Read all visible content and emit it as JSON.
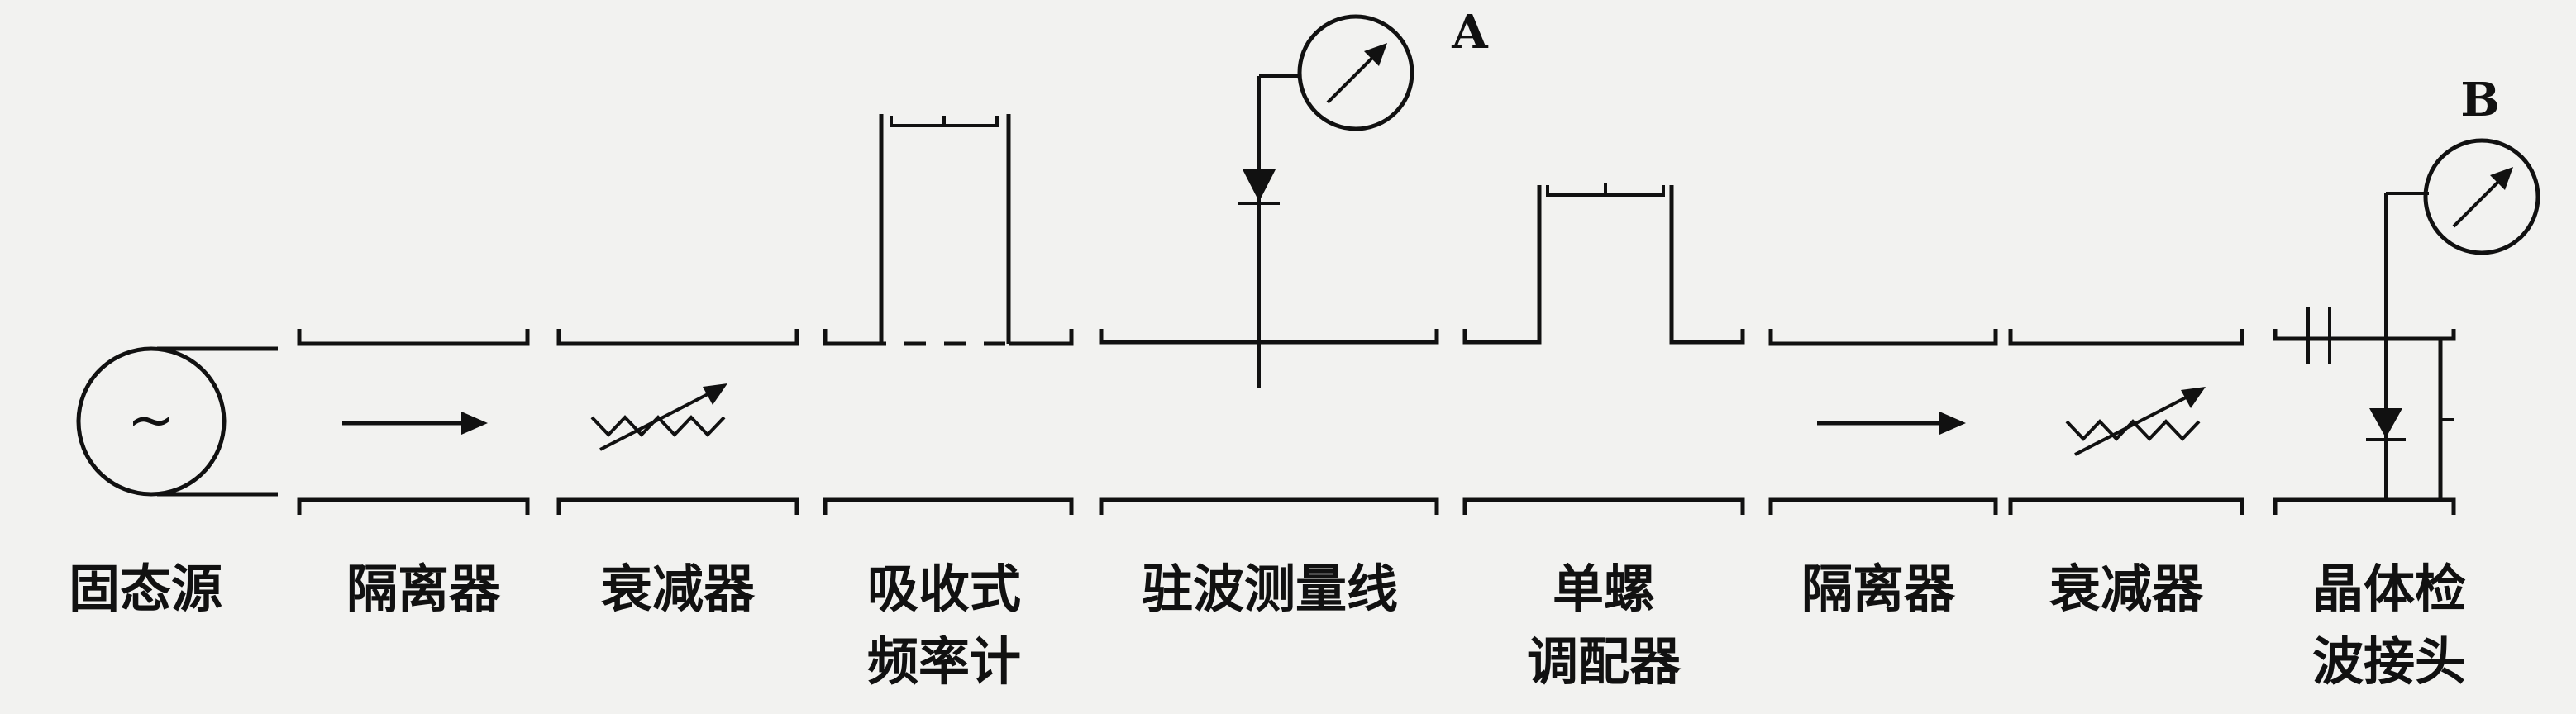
{
  "components": [
    {
      "id": "source",
      "label_lines": [
        "固态源"
      ]
    },
    {
      "id": "isolator1",
      "label_lines": [
        "隔离器"
      ]
    },
    {
      "id": "attenuator1",
      "label_lines": [
        "衰减器"
      ]
    },
    {
      "id": "wavemeter",
      "label_lines": [
        "吸收式",
        "频率计"
      ]
    },
    {
      "id": "slotted_line",
      "label_lines": [
        "驻波测量线"
      ]
    },
    {
      "id": "tuner",
      "label_lines": [
        "单螺",
        "调配器"
      ]
    },
    {
      "id": "isolator2",
      "label_lines": [
        "隔离器"
      ]
    },
    {
      "id": "attenuator2",
      "label_lines": [
        "衰减器"
      ]
    },
    {
      "id": "detector",
      "label_lines": [
        "晶体检",
        "波接头"
      ]
    }
  ],
  "meters": {
    "a": {
      "letter": "A"
    },
    "b": {
      "letter": "B"
    }
  },
  "source_symbol": "~"
}
